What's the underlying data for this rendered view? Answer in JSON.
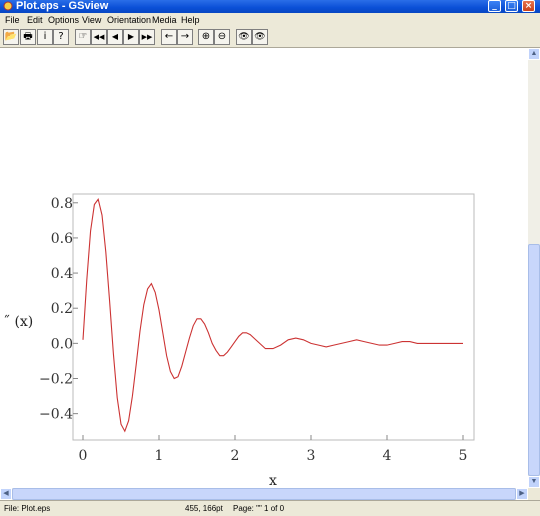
{
  "window": {
    "title": "Plot.eps - GSview",
    "minimize_glyph": "_",
    "maximize_glyph": "□",
    "close_glyph": "×"
  },
  "menu": [
    "File",
    "Edit",
    "Options",
    "View",
    "Orientation",
    "Media",
    "Help"
  ],
  "toolbar": {
    "buttons": [
      {
        "icon": "open-folder-icon",
        "glyph": "📂"
      },
      {
        "icon": "print-icon",
        "glyph": "🖶"
      },
      {
        "icon": "info-icon",
        "glyph": "i"
      },
      {
        "icon": "help-icon",
        "glyph": "?"
      },
      {
        "icon": "page-goto-icon",
        "glyph": "☞"
      },
      {
        "icon": "first-page-icon",
        "glyph": "◀◀"
      },
      {
        "icon": "prev-page-icon",
        "glyph": "◀"
      },
      {
        "icon": "next-page-icon",
        "glyph": "▶"
      },
      {
        "icon": "last-page-icon",
        "glyph": "▶▶"
      },
      {
        "icon": "back-arrow-icon",
        "glyph": "←"
      },
      {
        "icon": "forward-arrow-icon",
        "glyph": "→"
      },
      {
        "icon": "zoom-in-icon",
        "glyph": "⊕"
      },
      {
        "icon": "zoom-out-icon",
        "glyph": "⊖"
      },
      {
        "icon": "find-text-icon",
        "glyph": "👁"
      },
      {
        "icon": "find-next-icon",
        "glyph": "👁"
      }
    ]
  },
  "status": {
    "file": "File: Plot.eps",
    "coords": "455, 166pt",
    "page": "Page: \"\" 1 of 0"
  },
  "scroll_glyphs": {
    "up": "▲",
    "down": "▼",
    "left": "◀",
    "right": "▶"
  },
  "chart_data": {
    "type": "line",
    "xlabel": "x",
    "ylabel": "˝ (x)",
    "xlim": [
      0,
      5
    ],
    "ylim": [
      -0.55,
      0.85
    ],
    "xticks": [
      0,
      1,
      2,
      3,
      4,
      5
    ],
    "xtick_labels": [
      "0",
      "1",
      "2",
      "3",
      "4",
      "5"
    ],
    "yticks": [
      0.8,
      0.6,
      0.4,
      0.2,
      0.0,
      -0.2,
      -0.4
    ],
    "ytick_labels": [
      "0.8",
      "0.6",
      "0.4",
      "0.2",
      "0.0",
      "−0.2",
      "−0.4"
    ],
    "grid": false,
    "line_color": "#cc3333",
    "series": [
      {
        "x": [
          0,
          0.05,
          0.1,
          0.15,
          0.2,
          0.25,
          0.3,
          0.35,
          0.4,
          0.45,
          0.5,
          0.55,
          0.6,
          0.65,
          0.7,
          0.75,
          0.8,
          0.85,
          0.9,
          0.95,
          1.0,
          1.05,
          1.1,
          1.15,
          1.2,
          1.25,
          1.3,
          1.35,
          1.4,
          1.45,
          1.5,
          1.55,
          1.6,
          1.65,
          1.7,
          1.75,
          1.8,
          1.85,
          1.9,
          1.95,
          2.0,
          2.05,
          2.1,
          2.15,
          2.2,
          2.25,
          2.3,
          2.35,
          2.4,
          2.45,
          2.5,
          2.6,
          2.7,
          2.8,
          2.9,
          3.0,
          3.1,
          3.2,
          3.3,
          3.4,
          3.5,
          3.6,
          3.7,
          3.8,
          3.9,
          4.0,
          4.1,
          4.2,
          4.3,
          4.4,
          4.5,
          4.6,
          4.7,
          4.8,
          4.9,
          5.0
        ],
        "y": [
          0.02,
          0.36,
          0.64,
          0.79,
          0.82,
          0.73,
          0.52,
          0.24,
          -0.06,
          -0.31,
          -0.46,
          -0.5,
          -0.44,
          -0.3,
          -0.12,
          0.07,
          0.22,
          0.31,
          0.34,
          0.29,
          0.19,
          0.06,
          -0.07,
          -0.16,
          -0.2,
          -0.19,
          -0.13,
          -0.05,
          0.03,
          0.1,
          0.14,
          0.14,
          0.11,
          0.06,
          0.0,
          -0.04,
          -0.07,
          -0.07,
          -0.05,
          -0.02,
          0.01,
          0.04,
          0.06,
          0.06,
          0.05,
          0.03,
          0.01,
          -0.01,
          -0.03,
          -0.03,
          -0.03,
          -0.01,
          0.02,
          0.03,
          0.02,
          0.0,
          -0.01,
          -0.02,
          -0.01,
          0.0,
          0.01,
          0.02,
          0.01,
          0.0,
          -0.01,
          -0.01,
          0.0,
          0.01,
          0.01,
          0.0,
          0.0,
          0.0,
          0.0,
          0.0,
          0.0,
          0.0
        ]
      }
    ]
  }
}
